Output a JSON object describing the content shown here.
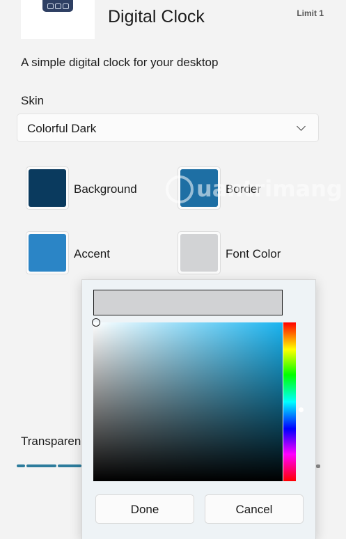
{
  "header": {
    "title": "Digital Clock",
    "limit": "Limit 1",
    "thumbnail_icon": "clock-display-icon"
  },
  "subtitle": "A simple digital clock for your desktop",
  "skin": {
    "label": "Skin",
    "selected": "Colorful Dark",
    "icon": "chevron-down-icon"
  },
  "colors": {
    "background": {
      "label": "Background",
      "value": "#0a3a5e"
    },
    "border": {
      "label": "Border",
      "value": "#1e6fa4"
    },
    "accent": {
      "label": "Accent",
      "value": "#2b85c6"
    },
    "font_color": {
      "label": "Font Color",
      "value": "#d2d3d5"
    }
  },
  "transparency": {
    "label": "Transparency",
    "visible_label": "Transparenc"
  },
  "picker": {
    "current_color": "#d1d2d4",
    "hue_color": "#1ab4f0",
    "done_label": "Done",
    "cancel_label": "Cancel"
  },
  "watermark": {
    "text": "uantrimang"
  }
}
